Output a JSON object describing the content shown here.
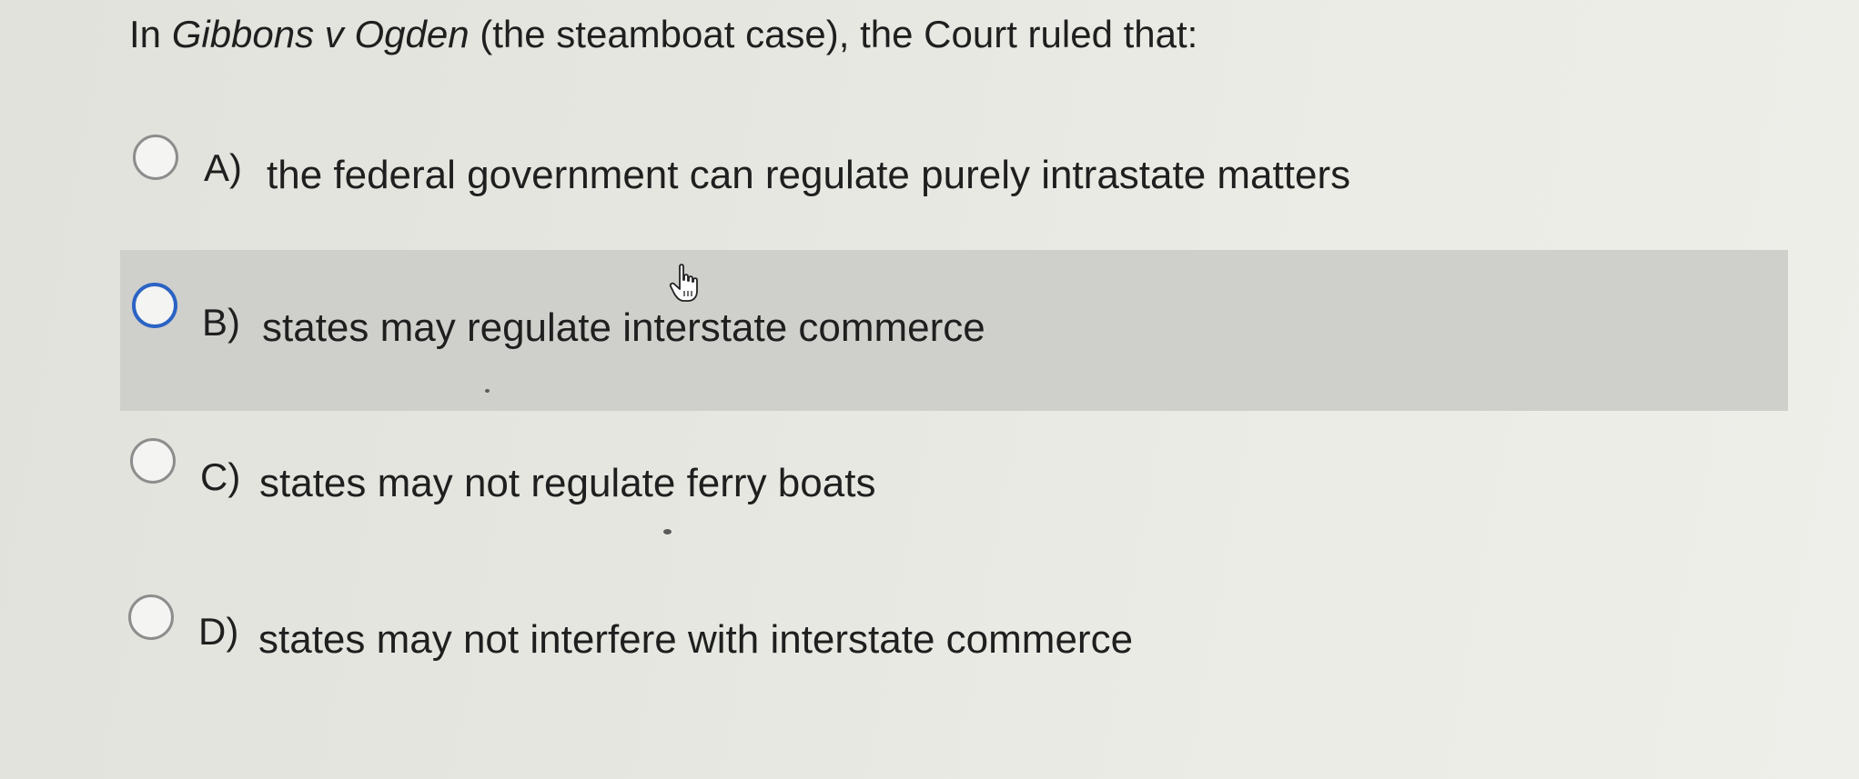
{
  "question": {
    "prefix": "In ",
    "case_name": "Gibbons v Ogden",
    "suffix": " (the steamboat case), the Court ruled that:"
  },
  "options": [
    {
      "letter": "A)",
      "text": "the federal government can regulate purely intrastate matters",
      "selected": false
    },
    {
      "letter": "B)",
      "text": "states may regulate interstate commerce",
      "selected": false,
      "hovered": true
    },
    {
      "letter": "C)",
      "text": "states may not regulate ferry boats",
      "selected": false
    },
    {
      "letter": "D)",
      "text": "states may not interfere with interstate commerce",
      "selected": false
    }
  ],
  "colors": {
    "hover_background": "#cfcfcb",
    "radio_border": "#8d8d8d",
    "radio_hover_border": "#2b63c4"
  },
  "icons": {
    "cursor": "hand-pointer-icon",
    "radio": "radio-button-icon"
  }
}
